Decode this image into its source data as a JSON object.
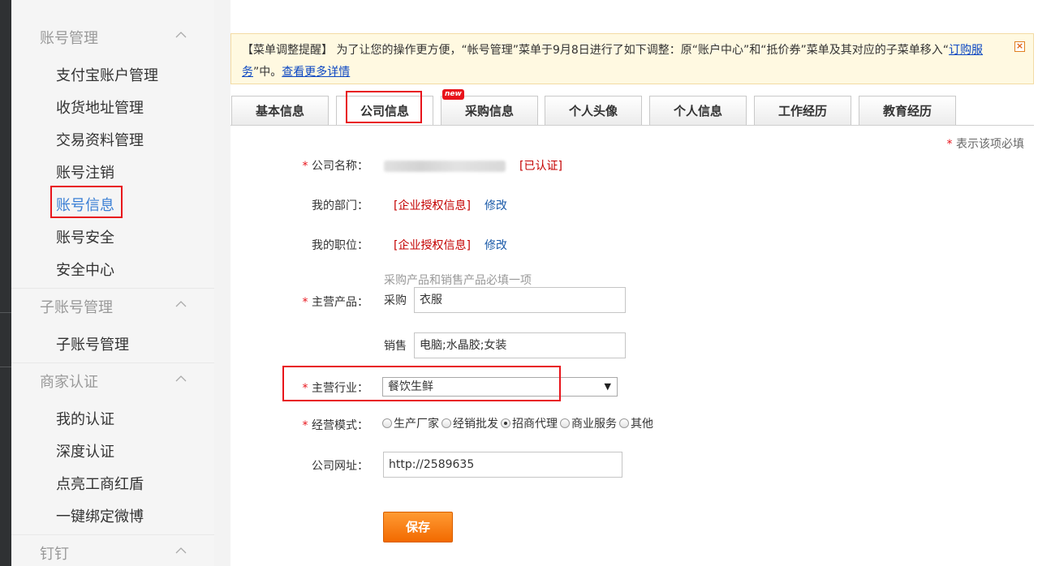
{
  "sidebar": {
    "groups": [
      {
        "title": "账号管理",
        "items": [
          "支付宝账户管理",
          "收货地址管理",
          "交易资料管理",
          "账号注销",
          "账号信息",
          "账号安全",
          "安全中心"
        ]
      },
      {
        "title": "子账号管理",
        "items": [
          "子账号管理"
        ]
      },
      {
        "title": "商家认证",
        "items": [
          "我的认证",
          "深度认证",
          "点亮工商红盾",
          "一键绑定微博"
        ]
      },
      {
        "title": "钉钉",
        "items": []
      }
    ],
    "active_item": "账号信息"
  },
  "notice": {
    "text_before": "【菜单调整提醒】 为了让您的操作更方便，“帐号管理”菜单于9月8日进行了如下调整：原“账户中心”和“抵价券”菜单及其对应的子菜单移入“",
    "link1": "订购服务",
    "text_after": "”中。",
    "link2": "查看更多详情"
  },
  "tabs": [
    "基本信息",
    "公司信息",
    "采购信息",
    "个人头像",
    "个人信息",
    "工作经历",
    "教育经历"
  ],
  "active_tab": "公司信息",
  "new_badge": "new",
  "required_note": "表示该项必填",
  "form": {
    "company_name": {
      "label": "公司名称：",
      "status": "[已认证]"
    },
    "department": {
      "label": "我的部门：",
      "value": "[企业授权信息]",
      "action": "修改"
    },
    "position": {
      "label": "我的职位：",
      "value": "[企业授权信息]",
      "action": "修改"
    },
    "products": {
      "label": "主营产品：",
      "hint": "采购产品和销售产品必填一项",
      "purchase_label": "采购",
      "purchase_value": "衣服",
      "sales_label": "销售",
      "sales_value": "电脑;水晶胶;女装"
    },
    "industry": {
      "label": "主营行业：",
      "value": "餐饮生鲜"
    },
    "business_mode": {
      "label": "经营模式：",
      "options": [
        "生产厂家",
        "经销批发",
        "招商代理",
        "商业服务",
        "其他"
      ],
      "selected": "招商代理"
    },
    "website": {
      "label": "公司网址：",
      "value": "http://2589635"
    },
    "save": "保存"
  },
  "colors": {
    "accent_orange": "#f26a00",
    "highlight_red": "#e8141b",
    "active_blue": "#3a7fd5"
  }
}
